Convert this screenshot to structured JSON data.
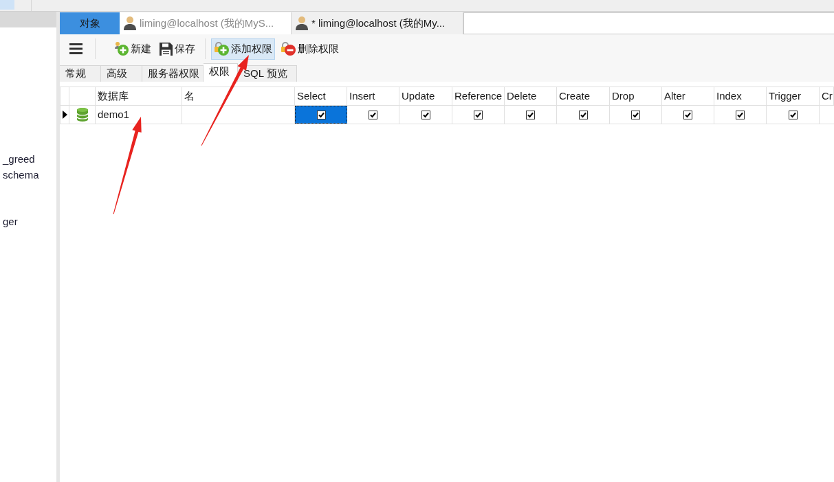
{
  "sidebar": {
    "items": [
      {
        "label": "_greed"
      },
      {
        "label": "schema"
      },
      {
        "label": "ger"
      }
    ]
  },
  "editor_tabs": [
    {
      "kind": "object",
      "label": "对象",
      "selected": false
    },
    {
      "kind": "user",
      "label": "liming@localhost (我的MyS...",
      "selected": false
    },
    {
      "kind": "user",
      "label": "* liming@localhost (我的My...",
      "selected": true
    }
  ],
  "toolbar": {
    "groups": [
      [
        {
          "kind": "new",
          "label": "新建",
          "highlighted": false
        },
        {
          "kind": "save",
          "label": "保存",
          "highlighted": false
        }
      ],
      [
        {
          "kind": "add_privilege",
          "label": "添加权限",
          "highlighted": true
        },
        {
          "kind": "delete_privilege",
          "label": "删除权限",
          "highlighted": false
        }
      ]
    ]
  },
  "sub_tabs": [
    {
      "label": "常规",
      "selected": false
    },
    {
      "label": "高级",
      "selected": false
    },
    {
      "label": "服务器权限",
      "selected": false
    },
    {
      "label": "权限",
      "selected": true
    },
    {
      "label": "SQL 预览",
      "selected": false
    }
  ],
  "table": {
    "columns": [
      "数据库",
      "名",
      "Select",
      "Insert",
      "Update",
      "Reference",
      "Delete",
      "Create",
      "Drop",
      "Alter",
      "Index",
      "Trigger",
      "Cr"
    ],
    "rows": [
      {
        "current": true,
        "database": "demo1",
        "privileges": [
          {
            "checked": true,
            "selected": true
          },
          {
            "checked": true,
            "selected": false
          },
          {
            "checked": true,
            "selected": false
          },
          {
            "checked": true,
            "selected": false
          },
          {
            "checked": true,
            "selected": false
          },
          {
            "checked": true,
            "selected": false
          },
          {
            "checked": true,
            "selected": false
          },
          {
            "checked": true,
            "selected": false
          },
          {
            "checked": true,
            "selected": false
          },
          {
            "checked": true,
            "selected": false
          }
        ]
      }
    ]
  }
}
